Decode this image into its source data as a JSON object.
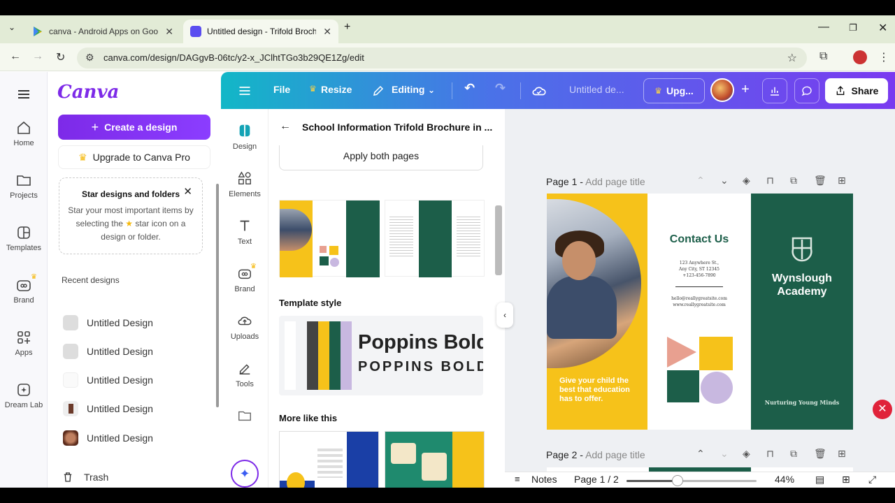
{
  "browser": {
    "tabs": [
      {
        "title": "canva - Android Apps on Goog"
      },
      {
        "title": "Untitled design - Trifold Brochu"
      }
    ],
    "url": "canva.com/design/DAGgvB-06tc/y2-x_JClhtTGo3b29QE1Zg/edit"
  },
  "rail": {
    "items": [
      {
        "label": "Home",
        "icon": "home-icon"
      },
      {
        "label": "Projects",
        "icon": "folder-icon"
      },
      {
        "label": "Templates",
        "icon": "templates-icon"
      },
      {
        "label": "Brand",
        "icon": "brand-icon"
      },
      {
        "label": "Apps",
        "icon": "apps-icon"
      },
      {
        "label": "Dream Lab",
        "icon": "dream-lab-icon"
      }
    ]
  },
  "side": {
    "logo": "Canva",
    "create_label": "Create a design",
    "upgrade_label": "Upgrade to Canva Pro",
    "star_box": {
      "title": "Star designs and folders",
      "body_pre": "Star your most important items by selecting the",
      "body_post": "star icon on a design or folder."
    },
    "recent_header": "Recent designs",
    "recent": [
      {
        "name": "Untitled Design"
      },
      {
        "name": "Untitled Design"
      },
      {
        "name": "Untitled Design"
      },
      {
        "name": "Untitled Design"
      },
      {
        "name": "Untitled Design"
      }
    ],
    "trash_label": "Trash"
  },
  "topbar": {
    "file": "File",
    "resize": "Resize",
    "editing": "Editing",
    "doc_title": "Untitled de...",
    "upgrade": "Upg...",
    "share": "Share"
  },
  "tools": [
    {
      "label": "Design"
    },
    {
      "label": "Elements"
    },
    {
      "label": "Text"
    },
    {
      "label": "Brand"
    },
    {
      "label": "Uploads"
    },
    {
      "label": "Tools"
    }
  ],
  "panel": {
    "title": "School Information Trifold Brochure in ...",
    "apply": "Apply both pages",
    "template_style": "Template style",
    "font_heading": "Poppins Bold",
    "font_sub": "POPPINS BOLD",
    "palette": [
      "#ffffff",
      "#444444",
      "#f6c21a",
      "#1c5e49",
      "#c8b8e0"
    ],
    "more_like_this": "More like this"
  },
  "canvas": {
    "page1_label": "Page 1 -",
    "page2_label": "Page 2 -",
    "add_title": "Add page title",
    "brochure": {
      "left_text": "Give your child the best that education has to offer.",
      "contact_title": "Contact Us",
      "address": [
        "123 Anywhere St.,",
        "Any City, ST 12345",
        "+123-456-7890"
      ],
      "contact": [
        "hello@reallygreatsite.com",
        "www.reallygreatsite.com"
      ],
      "school_name": "Wynslough Academy",
      "tagline": "Nurturing Young Minds"
    }
  },
  "bottom": {
    "notes": "Notes",
    "page_indicator": "Page 1 / 2",
    "zoom": "44%",
    "zoom_slider_fraction": 0.39
  },
  "colors": {
    "accent": "#7d2ae8",
    "brochure_yellow": "#f6c21a",
    "brochure_green": "#1c5e49"
  }
}
